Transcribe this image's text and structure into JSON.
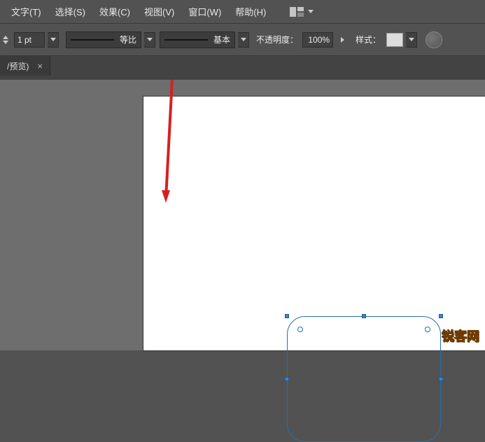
{
  "menu": {
    "items": [
      "文字(T)",
      "选择(S)",
      "效果(C)",
      "视图(V)",
      "窗口(W)",
      "帮助(H)"
    ]
  },
  "controlbar": {
    "stroke_value": "1 pt",
    "profile_label": "等比",
    "brush_label": "基本",
    "opacity_label": "不透明度：",
    "opacity_value": "100%",
    "style_label": "样式："
  },
  "tab": {
    "label": "/预览)",
    "close": "×"
  },
  "watermark": "锐客网"
}
